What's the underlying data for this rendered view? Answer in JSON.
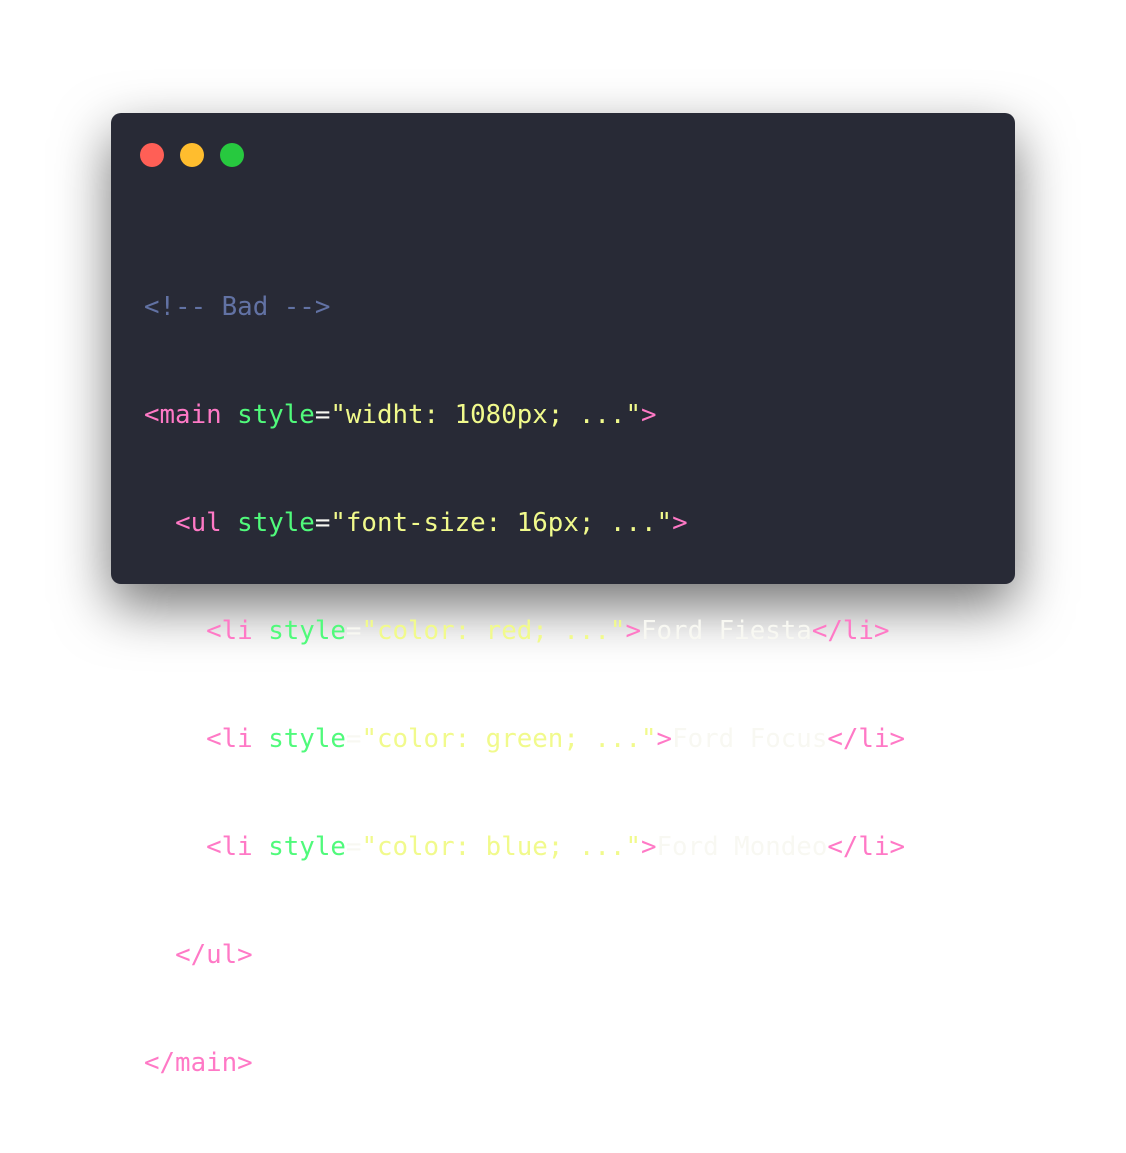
{
  "window": {
    "controls": {
      "close_color": "#ff5f56",
      "minimize_color": "#ffbd2e",
      "maximize_color": "#27c93f"
    }
  },
  "code": {
    "lines": [
      {
        "indent": "",
        "comment": "<!-- Bad -->"
      },
      {
        "indent": "",
        "open": "<main",
        "attr": " style",
        "eq": "=",
        "value": "\"widht: 1080px; ...\"",
        "close": ">"
      },
      {
        "indent": "  ",
        "open": "<ul",
        "attr": " style",
        "eq": "=",
        "value": "\"font-size: 16px; ...\"",
        "close": ">"
      },
      {
        "indent": "    ",
        "open": "<li",
        "attr": " style",
        "eq": "=",
        "value": "\"color: red; ...\"",
        "close": ">",
        "text": "Ford Fiesta",
        "end_tag": "</li>"
      },
      {
        "indent": "    ",
        "open": "<li",
        "attr": " style",
        "eq": "=",
        "value": "\"color: green; ...\"",
        "close": ">",
        "text": "Ford Focus",
        "end_tag": "</li>"
      },
      {
        "indent": "    ",
        "open": "<li",
        "attr": " style",
        "eq": "=",
        "value": "\"color: blue; ...\"",
        "close": ">",
        "text": "Ford Mondeo",
        "end_tag": "</li>"
      },
      {
        "indent": "  ",
        "end_tag": "</ul>"
      },
      {
        "indent": "",
        "end_tag": "</main>"
      }
    ]
  }
}
